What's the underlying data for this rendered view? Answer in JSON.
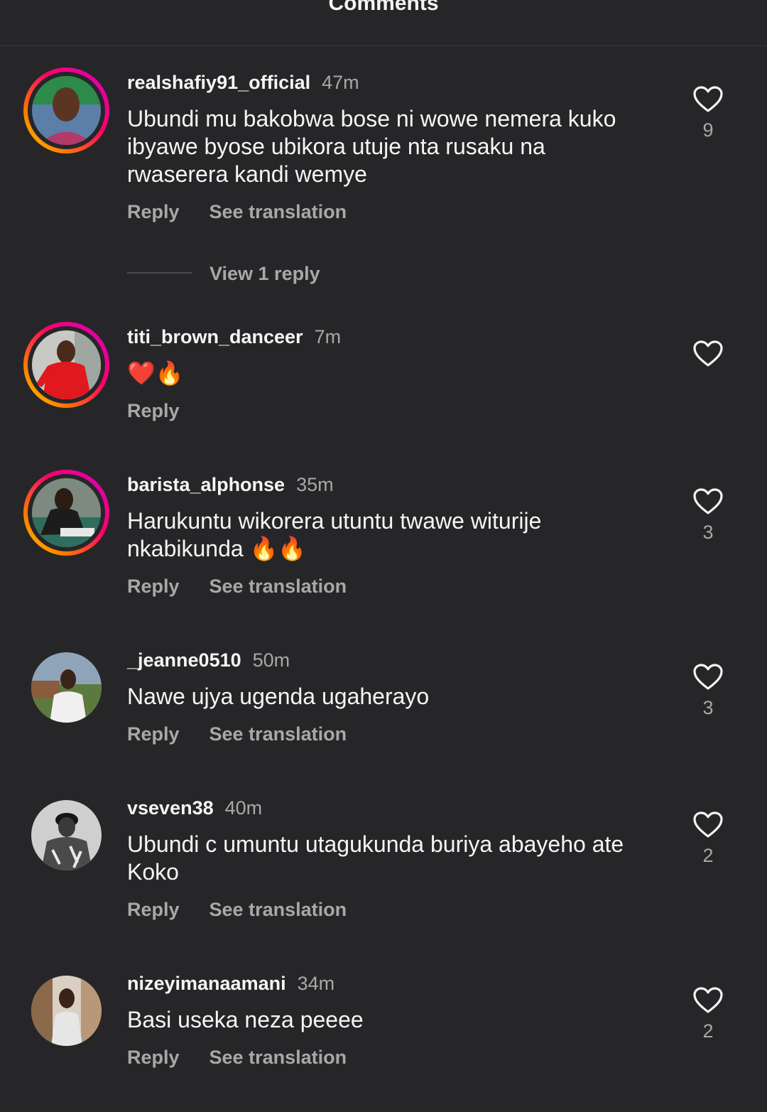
{
  "header": {
    "title": "Comments"
  },
  "comments": [
    {
      "username": "realshafiy91_official",
      "time": "47m",
      "text": "Ubundi mu bakobwa bose ni wowe nemera kuko ibyawe byose ubikora utuje nta rusaku na rwaserera kandi wemye",
      "reply_label": "Reply",
      "translate_label": "See translation",
      "likes": "9",
      "view_replies_label": "View 1 reply"
    },
    {
      "username": "titi_brown_danceer",
      "time": "7m",
      "text": "❤️🔥",
      "reply_label": "Reply",
      "likes": ""
    },
    {
      "username": "barista_alphonse",
      "time": "35m",
      "text": "Harukuntu wikorera utuntu twawe witurije nkabikunda 🔥🔥",
      "reply_label": "Reply",
      "translate_label": "See translation",
      "likes": "3"
    },
    {
      "username": "_jeanne0510",
      "time": "50m",
      "text": "Nawe ujya ugenda ugaherayo",
      "reply_label": "Reply",
      "translate_label": "See translation",
      "likes": "3"
    },
    {
      "username": "vseven38",
      "time": "40m",
      "text": "Ubundi c umuntu utagukunda buriya abayeho ate Koko",
      "reply_label": "Reply",
      "translate_label": "See translation",
      "likes": "2"
    },
    {
      "username": "nizeyimanaamani",
      "time": "34m",
      "text": "Basi useka neza peeee",
      "reply_label": "Reply",
      "translate_label": "See translation",
      "likes": "2"
    }
  ]
}
